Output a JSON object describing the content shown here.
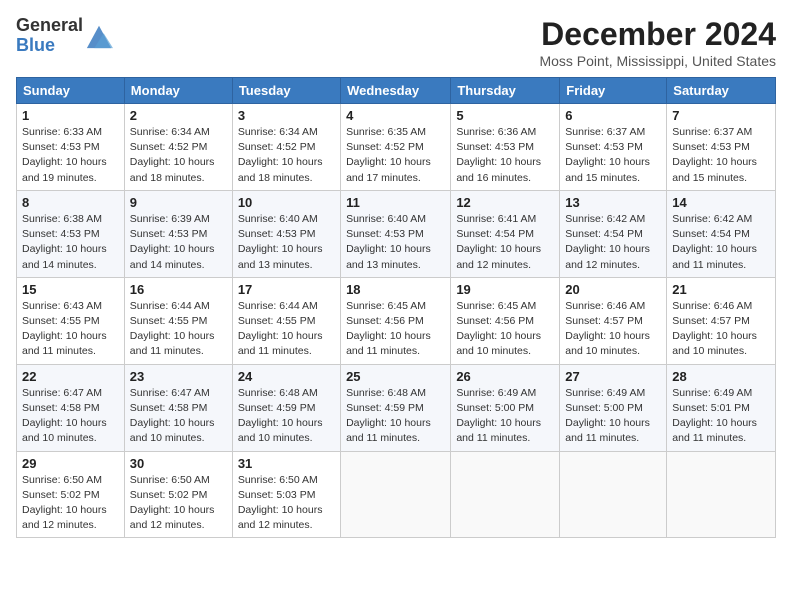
{
  "header": {
    "logo_general": "General",
    "logo_blue": "Blue",
    "month_title": "December 2024",
    "location": "Moss Point, Mississippi, United States"
  },
  "weekdays": [
    "Sunday",
    "Monday",
    "Tuesday",
    "Wednesday",
    "Thursday",
    "Friday",
    "Saturday"
  ],
  "weeks": [
    [
      {
        "day": "1",
        "sunrise": "6:33 AM",
        "sunset": "4:53 PM",
        "daylight": "10 hours and 19 minutes."
      },
      {
        "day": "2",
        "sunrise": "6:34 AM",
        "sunset": "4:52 PM",
        "daylight": "10 hours and 18 minutes."
      },
      {
        "day": "3",
        "sunrise": "6:34 AM",
        "sunset": "4:52 PM",
        "daylight": "10 hours and 18 minutes."
      },
      {
        "day": "4",
        "sunrise": "6:35 AM",
        "sunset": "4:52 PM",
        "daylight": "10 hours and 17 minutes."
      },
      {
        "day": "5",
        "sunrise": "6:36 AM",
        "sunset": "4:53 PM",
        "daylight": "10 hours and 16 minutes."
      },
      {
        "day": "6",
        "sunrise": "6:37 AM",
        "sunset": "4:53 PM",
        "daylight": "10 hours and 15 minutes."
      },
      {
        "day": "7",
        "sunrise": "6:37 AM",
        "sunset": "4:53 PM",
        "daylight": "10 hours and 15 minutes."
      }
    ],
    [
      {
        "day": "8",
        "sunrise": "6:38 AM",
        "sunset": "4:53 PM",
        "daylight": "10 hours and 14 minutes."
      },
      {
        "day": "9",
        "sunrise": "6:39 AM",
        "sunset": "4:53 PM",
        "daylight": "10 hours and 14 minutes."
      },
      {
        "day": "10",
        "sunrise": "6:40 AM",
        "sunset": "4:53 PM",
        "daylight": "10 hours and 13 minutes."
      },
      {
        "day": "11",
        "sunrise": "6:40 AM",
        "sunset": "4:53 PM",
        "daylight": "10 hours and 13 minutes."
      },
      {
        "day": "12",
        "sunrise": "6:41 AM",
        "sunset": "4:54 PM",
        "daylight": "10 hours and 12 minutes."
      },
      {
        "day": "13",
        "sunrise": "6:42 AM",
        "sunset": "4:54 PM",
        "daylight": "10 hours and 12 minutes."
      },
      {
        "day": "14",
        "sunrise": "6:42 AM",
        "sunset": "4:54 PM",
        "daylight": "10 hours and 11 minutes."
      }
    ],
    [
      {
        "day": "15",
        "sunrise": "6:43 AM",
        "sunset": "4:55 PM",
        "daylight": "10 hours and 11 minutes."
      },
      {
        "day": "16",
        "sunrise": "6:44 AM",
        "sunset": "4:55 PM",
        "daylight": "10 hours and 11 minutes."
      },
      {
        "day": "17",
        "sunrise": "6:44 AM",
        "sunset": "4:55 PM",
        "daylight": "10 hours and 11 minutes."
      },
      {
        "day": "18",
        "sunrise": "6:45 AM",
        "sunset": "4:56 PM",
        "daylight": "10 hours and 11 minutes."
      },
      {
        "day": "19",
        "sunrise": "6:45 AM",
        "sunset": "4:56 PM",
        "daylight": "10 hours and 10 minutes."
      },
      {
        "day": "20",
        "sunrise": "6:46 AM",
        "sunset": "4:57 PM",
        "daylight": "10 hours and 10 minutes."
      },
      {
        "day": "21",
        "sunrise": "6:46 AM",
        "sunset": "4:57 PM",
        "daylight": "10 hours and 10 minutes."
      }
    ],
    [
      {
        "day": "22",
        "sunrise": "6:47 AM",
        "sunset": "4:58 PM",
        "daylight": "10 hours and 10 minutes."
      },
      {
        "day": "23",
        "sunrise": "6:47 AM",
        "sunset": "4:58 PM",
        "daylight": "10 hours and 10 minutes."
      },
      {
        "day": "24",
        "sunrise": "6:48 AM",
        "sunset": "4:59 PM",
        "daylight": "10 hours and 10 minutes."
      },
      {
        "day": "25",
        "sunrise": "6:48 AM",
        "sunset": "4:59 PM",
        "daylight": "10 hours and 11 minutes."
      },
      {
        "day": "26",
        "sunrise": "6:49 AM",
        "sunset": "5:00 PM",
        "daylight": "10 hours and 11 minutes."
      },
      {
        "day": "27",
        "sunrise": "6:49 AM",
        "sunset": "5:00 PM",
        "daylight": "10 hours and 11 minutes."
      },
      {
        "day": "28",
        "sunrise": "6:49 AM",
        "sunset": "5:01 PM",
        "daylight": "10 hours and 11 minutes."
      }
    ],
    [
      {
        "day": "29",
        "sunrise": "6:50 AM",
        "sunset": "5:02 PM",
        "daylight": "10 hours and 12 minutes."
      },
      {
        "day": "30",
        "sunrise": "6:50 AM",
        "sunset": "5:02 PM",
        "daylight": "10 hours and 12 minutes."
      },
      {
        "day": "31",
        "sunrise": "6:50 AM",
        "sunset": "5:03 PM",
        "daylight": "10 hours and 12 minutes."
      },
      null,
      null,
      null,
      null
    ]
  ],
  "labels": {
    "sunrise": "Sunrise:",
    "sunset": "Sunset:",
    "daylight": "Daylight:"
  }
}
